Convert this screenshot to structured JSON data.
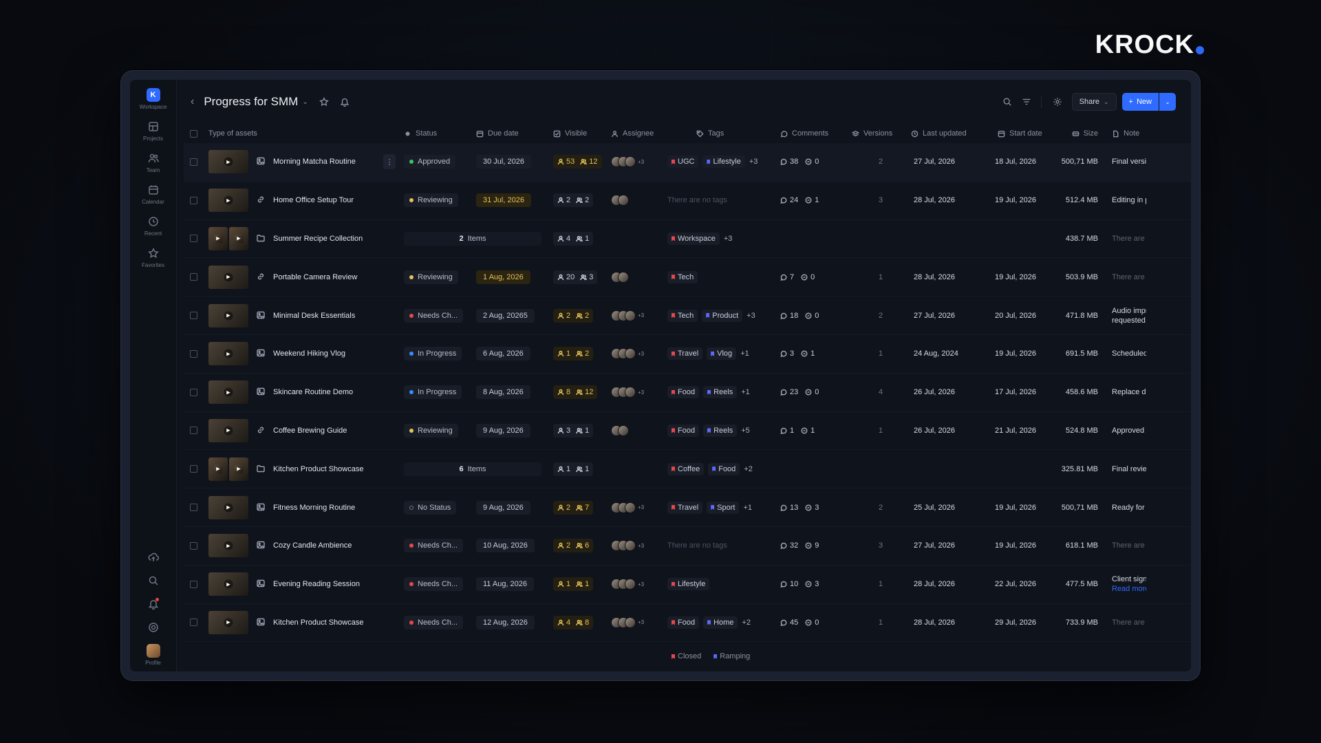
{
  "brand": {
    "name": "KROCK"
  },
  "colors": {
    "accent": "#2f6bff",
    "approved": "#3cc36a",
    "reviewing": "#e6c15a",
    "needs_changes": "#e5484d",
    "in_progress": "#3b8bff",
    "no_status": "#6f7786"
  },
  "sidebar": {
    "workspace_initial": "K",
    "items": [
      {
        "label": "Workspace",
        "icon": "workspace-icon"
      },
      {
        "label": "Projects",
        "icon": "projects-icon"
      },
      {
        "label": "Team",
        "icon": "team-icon"
      },
      {
        "label": "Calendar",
        "icon": "calendar-icon"
      },
      {
        "label": "Recent",
        "icon": "clock-icon"
      },
      {
        "label": "Favorites",
        "icon": "star-icon"
      }
    ],
    "bottom": {
      "profile_label": "Profile"
    }
  },
  "header": {
    "title": "Progress for SMM",
    "share_label": "Share",
    "new_label": "New"
  },
  "columns": {
    "type": "Type of assets",
    "status": "Status",
    "due": "Due date",
    "visible": "Visible",
    "assignee": "Assignee",
    "tags": "Tags",
    "comments": "Comments",
    "versions": "Versions",
    "updated": "Last updated",
    "start": "Start date",
    "size": "Size",
    "note": "Note"
  },
  "rows": [
    {
      "name": "Morning Matcha Routine",
      "type": "image",
      "status": "Approved",
      "status_color": "#3cc36a",
      "due": "30 Jul, 2026",
      "due_warn": false,
      "vis_a": "53",
      "vis_b": "12",
      "vis_y": true,
      "avatars": 3,
      "av_more": "+3",
      "tags": [
        {
          "t": "UGC",
          "c": "#e5484d"
        },
        {
          "t": "Lifestyle",
          "c": "#5b6cff"
        }
      ],
      "tag_more": "+3",
      "no_tags": "",
      "c1": "38",
      "c2": "0",
      "ver": "2",
      "updated": "27 Jul, 2026",
      "start": "18 Jul, 2026",
      "size": "500,71 MB",
      "note": "Final versio",
      "note2": ""
    },
    {
      "name": "Home Office Setup Tour",
      "type": "link",
      "status": "Reviewing",
      "status_color": "#e6c15a",
      "due": "31 Jul, 2026",
      "due_warn": true,
      "vis_a": "2",
      "vis_b": "2",
      "vis_y": false,
      "avatars": 2,
      "av_more": "",
      "tags": [],
      "tag_more": "",
      "no_tags": "There are no tags",
      "c1": "24",
      "c2": "1",
      "ver": "3",
      "updated": "28 Jul, 2026",
      "start": "19 Jul, 2026",
      "size": "512.4 MB",
      "note": "Editing in p",
      "note2": ""
    },
    {
      "name": "Summer Recipe Collection",
      "type": "folder",
      "items_count": "2",
      "items_label": "Items",
      "vis_a": "4",
      "vis_b": "1",
      "vis_y": false,
      "tags": [
        {
          "t": "Workspace",
          "c": "#e5484d"
        }
      ],
      "tag_more": "+3",
      "no_tags": "",
      "size": "438.7 MB",
      "note": "There are n",
      "note_dim": true
    },
    {
      "name": "Portable Camera Review",
      "type": "link",
      "status": "Reviewing",
      "status_color": "#e6c15a",
      "due": "1 Aug, 2026",
      "due_warn": true,
      "vis_a": "20",
      "vis_b": "3",
      "vis_y": false,
      "avatars": 2,
      "av_more": "",
      "tags": [
        {
          "t": "Tech",
          "c": "#e5484d"
        }
      ],
      "tag_more": "",
      "no_tags": "",
      "c1": "7",
      "c2": "0",
      "ver": "1",
      "updated": "28 Jul, 2026",
      "start": "19 Jul, 2026",
      "size": "503.9 MB",
      "note": "There are n",
      "note_dim": true
    },
    {
      "name": "Minimal Desk Essentials",
      "type": "image",
      "status": "Needs Ch...",
      "status_color": "#e5484d",
      "due": "2 Aug, 20265",
      "due_warn": false,
      "vis_a": "2",
      "vis_b": "2",
      "vis_y": true,
      "avatars": 3,
      "av_more": "+3",
      "tags": [
        {
          "t": "Tech",
          "c": "#e5484d"
        },
        {
          "t": "Product",
          "c": "#5b6cff"
        }
      ],
      "tag_more": "+3",
      "no_tags": "",
      "c1": "18",
      "c2": "0",
      "ver": "2",
      "updated": "27 Jul, 2026",
      "start": "20 Jul, 2026",
      "size": "471.8 MB",
      "note": "Audio impr",
      "note2": "requested."
    },
    {
      "name": "Weekend Hiking Vlog",
      "type": "image",
      "status": "In Progress",
      "status_color": "#3b8bff",
      "due": "6 Aug, 2026",
      "due_warn": false,
      "vis_a": "1",
      "vis_b": "2",
      "vis_y": true,
      "avatars": 3,
      "av_more": "+3",
      "tags": [
        {
          "t": "Travel",
          "c": "#e5484d"
        },
        {
          "t": "Vlog",
          "c": "#5b6cff"
        }
      ],
      "tag_more": "+1",
      "no_tags": "",
      "c1": "3",
      "c2": "1",
      "ver": "1",
      "updated": "24 Aug, 2024",
      "start": "19 Jul, 2026",
      "size": "691.5 MB",
      "note": "Scheduled",
      "note2": ""
    },
    {
      "name": "Skincare Routine Demo",
      "type": "image",
      "status": "In Progress",
      "status_color": "#3b8bff",
      "due": "8 Aug, 2026",
      "due_warn": false,
      "vis_a": "8",
      "vis_b": "12",
      "vis_y": true,
      "avatars": 3,
      "av_more": "+3",
      "tags": [
        {
          "t": "Food",
          "c": "#e5484d"
        },
        {
          "t": "Reels",
          "c": "#5b6cff"
        }
      ],
      "tag_more": "+1",
      "no_tags": "",
      "c1": "23",
      "c2": "0",
      "ver": "4",
      "updated": "26 Jul, 2026",
      "start": "17 Jul, 2026",
      "size": "458.6 MB",
      "note": "Replace dr",
      "note2": ""
    },
    {
      "name": "Coffee Brewing Guide",
      "type": "link",
      "status": "Reviewing",
      "status_color": "#e6c15a",
      "due": "9 Aug, 2026",
      "due_warn": false,
      "vis_a": "3",
      "vis_b": "1",
      "vis_y": false,
      "avatars": 2,
      "av_more": "",
      "tags": [
        {
          "t": "Food",
          "c": "#e5484d"
        },
        {
          "t": "Reels",
          "c": "#5b6cff"
        }
      ],
      "tag_more": "+5",
      "no_tags": "",
      "c1": "1",
      "c2": "1",
      "ver": "1",
      "updated": "26 Jul, 2026",
      "start": "21 Jul, 2026",
      "size": "524.8 MB",
      "note": "Approved b",
      "note2": ""
    },
    {
      "name": "Kitchen Product Showcase",
      "type": "folder",
      "items_count": "6",
      "items_label": "Items",
      "vis_a": "1",
      "vis_b": "1",
      "vis_y": false,
      "tags": [
        {
          "t": "Coffee",
          "c": "#e5484d"
        },
        {
          "t": "Food",
          "c": "#5b6cff"
        }
      ],
      "tag_more": "+2",
      "no_tags": "",
      "size": "325.81 MB",
      "note": "Final review",
      "note_dim": false
    },
    {
      "name": "Fitness Morning Routine",
      "type": "image",
      "status": "No Status",
      "status_color": "#6f7786",
      "due": "9 Aug, 2026",
      "due_warn": false,
      "vis_a": "2",
      "vis_b": "7",
      "vis_y": true,
      "avatars": 3,
      "av_more": "+3",
      "tags": [
        {
          "t": "Travel",
          "c": "#e5484d"
        },
        {
          "t": "Sport",
          "c": "#5b6cff"
        }
      ],
      "tag_more": "+1",
      "no_tags": "",
      "c1": "13",
      "c2": "3",
      "ver": "2",
      "updated": "25 Jul, 2026",
      "start": "19 Jul, 2026",
      "size": "500,71 MB",
      "note": "Ready for s",
      "note2": ""
    },
    {
      "name": "Cozy Candle Ambience",
      "type": "image",
      "status": "Needs Ch...",
      "status_color": "#e5484d",
      "due": "10 Aug, 2026",
      "due_warn": false,
      "vis_a": "2",
      "vis_b": "6",
      "vis_y": true,
      "avatars": 3,
      "av_more": "+3",
      "tags": [],
      "tag_more": "",
      "no_tags": "There are no tags",
      "c1": "32",
      "c2": "9",
      "ver": "3",
      "updated": "27 Jul, 2026",
      "start": "19 Jul, 2026",
      "size": "618.1 MB",
      "note": "There are n",
      "note_dim": true
    },
    {
      "name": "Evening Reading Session",
      "type": "image",
      "status": "Needs Ch...",
      "status_color": "#e5484d",
      "due": "11 Aug, 2026",
      "due_warn": false,
      "vis_a": "1",
      "vis_b": "1",
      "vis_y": true,
      "avatars": 3,
      "av_more": "+3",
      "tags": [
        {
          "t": "Lifestyle",
          "c": "#e5484d"
        }
      ],
      "tag_more": "",
      "no_tags": "",
      "c1": "10",
      "c2": "3",
      "ver": "1",
      "updated": "28 Jul, 2026",
      "start": "22 Jul, 2026",
      "size": "477.5 MB",
      "note": "Client sign",
      "note2": "Read more",
      "note2_link": true
    },
    {
      "name": "Kitchen Product Showcase",
      "type": "image",
      "status": "Needs Ch...",
      "status_color": "#e5484d",
      "due": "12 Aug, 2026",
      "due_warn": false,
      "vis_a": "4",
      "vis_b": "8",
      "vis_y": true,
      "avatars": 3,
      "av_more": "+3",
      "tags": [
        {
          "t": "Food",
          "c": "#e5484d"
        },
        {
          "t": "Home",
          "c": "#5b6cff"
        }
      ],
      "tag_more": "+2",
      "no_tags": "",
      "c1": "45",
      "c2": "0",
      "ver": "1",
      "updated": "28 Jul, 2026",
      "start": "29 Jul, 2026",
      "size": "733.9 MB",
      "note": "There are n",
      "note_dim": true
    }
  ],
  "partial_row": {
    "tags": [
      {
        "t": "Closed",
        "c": "#e5484d"
      },
      {
        "t": "Ramping",
        "c": "#5b6cff"
      }
    ]
  }
}
